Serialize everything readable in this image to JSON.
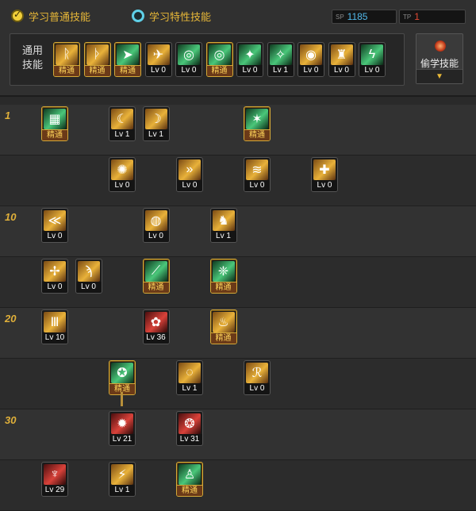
{
  "tabs": {
    "normal": "学习普通技能",
    "trait": "学习特性技能"
  },
  "points": {
    "sp_tag": "SP",
    "sp_value": "1185",
    "tp_tag": "TP",
    "tp_value": "1"
  },
  "common": {
    "label": "通用技能",
    "skills": [
      {
        "level": "精通",
        "mastered": true,
        "color": "gold",
        "glyph": "ᚱ"
      },
      {
        "level": "精通",
        "mastered": true,
        "color": "gold",
        "glyph": "ᚦ"
      },
      {
        "level": "精通",
        "mastered": true,
        "color": "green",
        "glyph": "➤"
      },
      {
        "level": "Lv 0",
        "mastered": false,
        "color": "gold",
        "glyph": "✈"
      },
      {
        "level": "Lv 0",
        "mastered": false,
        "color": "green",
        "glyph": "◎"
      },
      {
        "level": "精通",
        "mastered": true,
        "color": "green",
        "glyph": "◎"
      },
      {
        "level": "Lv 0",
        "mastered": false,
        "color": "green",
        "glyph": "✦"
      },
      {
        "level": "Lv 1",
        "mastered": false,
        "color": "green",
        "glyph": "✧"
      },
      {
        "level": "Lv 0",
        "mastered": false,
        "color": "gold",
        "glyph": "◉"
      },
      {
        "level": "Lv 0",
        "mastered": false,
        "color": "gold",
        "glyph": "♜"
      },
      {
        "level": "Lv 0",
        "mastered": false,
        "color": "green",
        "glyph": "ϟ"
      }
    ]
  },
  "steal": {
    "label": "偷学技能",
    "arrow": "▼"
  },
  "tree": {
    "rows": [
      {
        "label": "1",
        "skills": [
          {
            "col": 0,
            "level": "精通",
            "mastered": true,
            "color": "green",
            "glyph": "▦"
          },
          {
            "col": 2,
            "level": "Lv 1",
            "mastered": false,
            "color": "gold",
            "glyph": "☾"
          },
          {
            "col": 3,
            "level": "Lv 1",
            "mastered": false,
            "color": "gold",
            "glyph": "☽"
          },
          {
            "col": 6,
            "level": "精通",
            "mastered": true,
            "color": "green",
            "glyph": "✶"
          }
        ]
      },
      {
        "label": "",
        "skills": [
          {
            "col": 2,
            "level": "Lv 0",
            "mastered": false,
            "color": "gold",
            "glyph": "✺"
          },
          {
            "col": 4,
            "level": "Lv 0",
            "mastered": false,
            "color": "gold",
            "glyph": "»"
          },
          {
            "col": 6,
            "level": "Lv 0",
            "mastered": false,
            "color": "gold",
            "glyph": "≋"
          },
          {
            "col": 8,
            "level": "Lv 0",
            "mastered": false,
            "color": "gold",
            "glyph": "✚"
          }
        ]
      },
      {
        "label": "10",
        "skills": [
          {
            "col": 0,
            "level": "Lv 0",
            "mastered": false,
            "color": "gold",
            "glyph": "≪"
          },
          {
            "col": 3,
            "level": "Lv 0",
            "mastered": false,
            "color": "gold",
            "glyph": "◍"
          },
          {
            "col": 5,
            "level": "Lv 1",
            "mastered": false,
            "color": "gold",
            "glyph": "♞"
          }
        ]
      },
      {
        "label": "",
        "skills": [
          {
            "col": 0,
            "level": "Lv 0",
            "mastered": false,
            "color": "gold",
            "glyph": "✢"
          },
          {
            "col": 1,
            "level": "Lv 0",
            "mastered": false,
            "color": "gold",
            "glyph": "ϡ"
          },
          {
            "col": 3,
            "level": "精通",
            "mastered": true,
            "color": "green",
            "glyph": "⟋"
          },
          {
            "col": 5,
            "level": "精通",
            "mastered": true,
            "color": "green",
            "glyph": "❈"
          }
        ]
      },
      {
        "label": "20",
        "skills": [
          {
            "col": 0,
            "level": "Lv 10",
            "mastered": false,
            "color": "gold",
            "glyph": "Ⅲ"
          },
          {
            "col": 3,
            "level": "Lv 36",
            "mastered": false,
            "color": "red",
            "glyph": "✿"
          },
          {
            "col": 5,
            "level": "精通",
            "mastered": true,
            "color": "gold",
            "glyph": "♨"
          }
        ]
      },
      {
        "label": "",
        "skills": [
          {
            "col": 2,
            "level": "精通",
            "mastered": true,
            "color": "green",
            "glyph": "✪"
          },
          {
            "col": 4,
            "level": "Lv 1",
            "mastered": false,
            "color": "gold",
            "glyph": "◌"
          },
          {
            "col": 6,
            "level": "Lv 0",
            "mastered": false,
            "color": "gold",
            "glyph": "ℛ"
          }
        ]
      },
      {
        "label": "30",
        "skills": [
          {
            "col": 2,
            "level": "Lv 21",
            "mastered": false,
            "color": "red",
            "glyph": "✹"
          },
          {
            "col": 4,
            "level": "Lv 31",
            "mastered": false,
            "color": "red",
            "glyph": "❂"
          }
        ]
      },
      {
        "label": "",
        "skills": [
          {
            "col": 0,
            "level": "Lv 29",
            "mastered": false,
            "color": "red",
            "glyph": "♆"
          },
          {
            "col": 2,
            "level": "Lv 1",
            "mastered": false,
            "color": "gold",
            "glyph": "⚡"
          },
          {
            "col": 4,
            "level": "精通",
            "mastered": true,
            "color": "green",
            "glyph": "♙"
          }
        ]
      }
    ]
  }
}
